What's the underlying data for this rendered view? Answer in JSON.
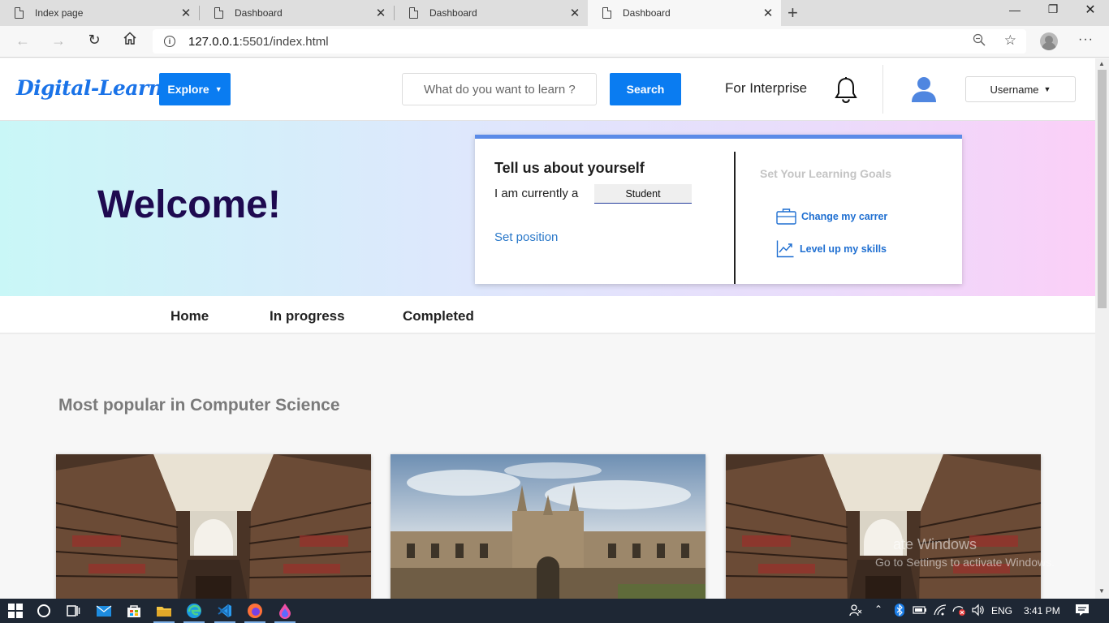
{
  "browser": {
    "tabs": [
      {
        "title": "Index page",
        "active": false
      },
      {
        "title": "Dashboard",
        "active": false
      },
      {
        "title": "Dashboard",
        "active": false
      },
      {
        "title": "Dashboard",
        "active": true
      }
    ],
    "url_host": "127.0.0.1",
    "url_rest": ":5501/index.html",
    "new_tab_glyph": "+",
    "window_controls": [
      "minimize",
      "restore",
      "close"
    ]
  },
  "header": {
    "logo": "Digital-Learn",
    "explore_label": "Explore",
    "search_placeholder": "What do you want to learn ?",
    "search_label": "Search",
    "enterprise_label": "For Interprise",
    "username_label": "Username"
  },
  "hero": {
    "welcome": "Welcome!",
    "card": {
      "title": "Tell us about yourself",
      "currently_label": "I am currently a",
      "role_value": "Student",
      "set_position": "Set position",
      "goals_title": "Set Your Learning Goals",
      "goals": [
        {
          "label": "Change my carrer",
          "icon": "briefcase-icon"
        },
        {
          "label": "Level up my skills",
          "icon": "trending-up-icon"
        }
      ]
    }
  },
  "subnav": {
    "items": [
      "Home",
      "In progress",
      "Completed"
    ]
  },
  "section": {
    "title": "Most popular in Computer Science"
  },
  "courses": [
    {
      "image": "library"
    },
    {
      "image": "college"
    },
    {
      "image": "library"
    }
  ],
  "taskbar": {
    "language": "ENG",
    "time": "3:41 PM"
  },
  "watermark": {
    "line1": "ate Windows",
    "line2": "Go to Settings to activate Windows."
  },
  "colors": {
    "accent": "#0a7cf1",
    "welcome": "#1e0a50",
    "link": "#2a78c9",
    "card_border": "#5b8be8"
  }
}
